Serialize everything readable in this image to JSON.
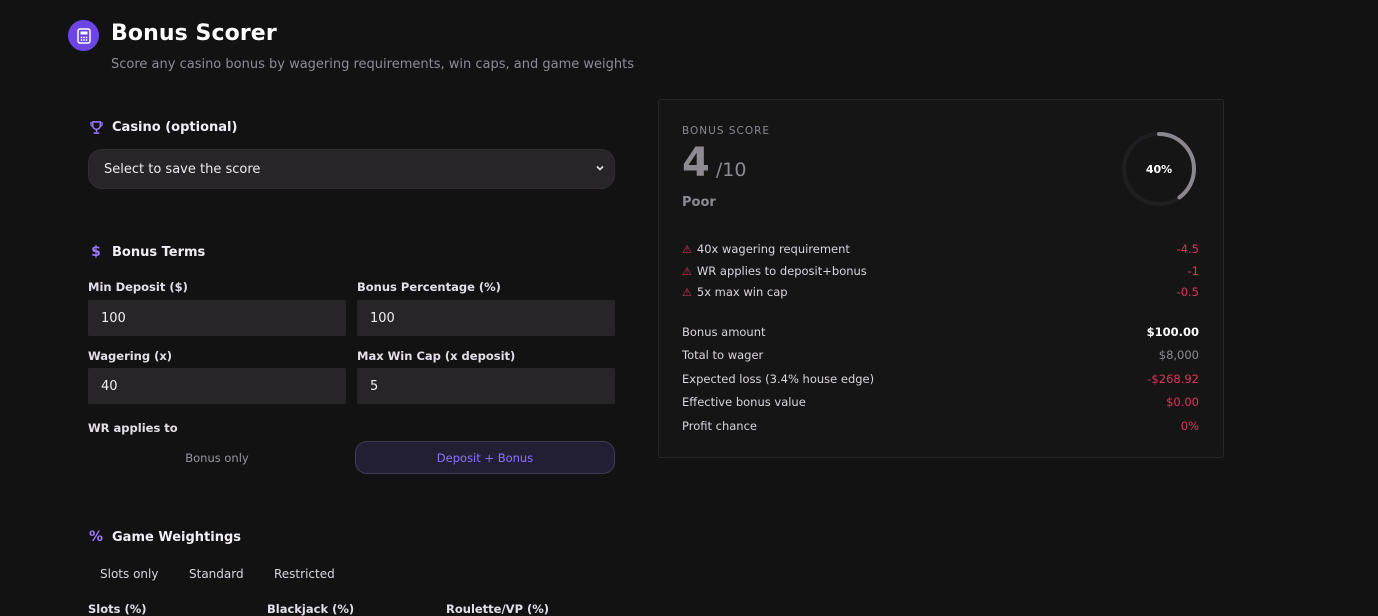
{
  "header": {
    "title": "Bonus Scorer",
    "subtitle": "Score any casino bonus by wagering requirements, win caps, and game weights"
  },
  "casino": {
    "heading": "Casino (optional)",
    "select_value": "Select to save the score"
  },
  "terms": {
    "heading": "Bonus Terms",
    "min_deposit_label": "Min Deposit ($)",
    "min_deposit_value": "100",
    "bonus_pct_label": "Bonus Percentage (%)",
    "bonus_pct_value": "100",
    "wagering_label": "Wagering (x)",
    "wagering_value": "40",
    "max_win_label": "Max Win Cap (x deposit)",
    "max_win_value": "5",
    "wr_label": "WR applies to",
    "wr_options": [
      "Bonus only",
      "Deposit + Bonus"
    ],
    "wr_selected": "Deposit + Bonus"
  },
  "weightings": {
    "heading": "Game Weightings",
    "presets": [
      "Slots only",
      "Standard",
      "Restricted"
    ],
    "fields": [
      "Slots (%)",
      "Blackjack (%)",
      "Roulette/VP (%)"
    ]
  },
  "score_card": {
    "label": "BONUS SCORE",
    "score": "4",
    "max": "/10",
    "rating": "Poor",
    "ring_text": "40%",
    "ring_fraction": 0.4,
    "penalties": [
      {
        "text": "40x wagering requirement",
        "value": "-4.5"
      },
      {
        "text": "WR applies to deposit+bonus",
        "value": "-1"
      },
      {
        "text": "5x max win cap",
        "value": "-0.5"
      }
    ],
    "stats": [
      {
        "label": "Bonus amount",
        "value": "$100.00"
      },
      {
        "label": "Total to wager",
        "value": "$8,000"
      },
      {
        "label": "Expected loss (3.4% house edge)",
        "value": "-$268.92"
      },
      {
        "label": "Effective bonus value",
        "value": "$0.00"
      },
      {
        "label": "Profit chance",
        "value": "0%"
      }
    ]
  },
  "colors": {
    "accent": "#6b46e5",
    "negative": "#e0345c",
    "background": "#131213"
  }
}
